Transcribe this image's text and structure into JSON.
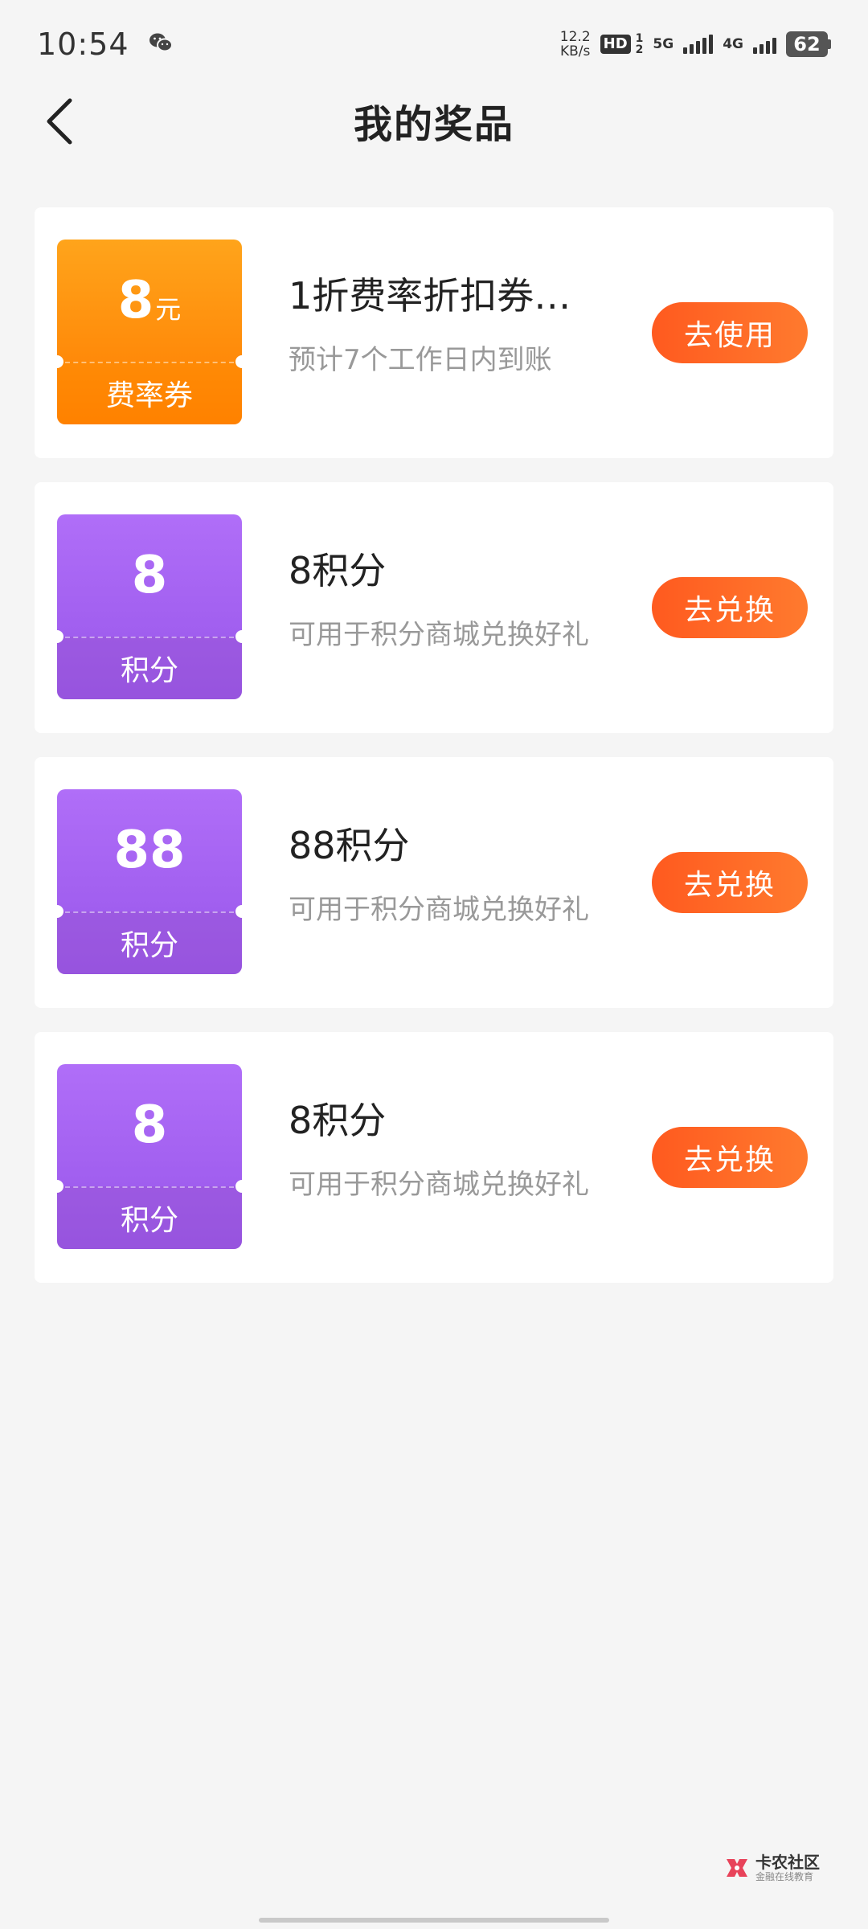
{
  "status_bar": {
    "time": "10:54",
    "net_speed_value": "12.2",
    "net_speed_unit": "KB/s",
    "hd_label": "HD",
    "sim1_label": "5G",
    "sim2_label": "4G",
    "battery": "62"
  },
  "header": {
    "title": "我的奖品"
  },
  "prizes": [
    {
      "badge_value": "8",
      "badge_unit": "元",
      "badge_label": "费率券",
      "title": "1折费率折扣券…",
      "description": "预计7个工作日内到账",
      "action_label": "去使用"
    },
    {
      "badge_value": "8",
      "badge_unit": "",
      "badge_label": "积分",
      "title": "8积分",
      "description": "可用于积分商城兑换好礼",
      "action_label": "去兑换"
    },
    {
      "badge_value": "88",
      "badge_unit": "",
      "badge_label": "积分",
      "title": "88积分",
      "description": "可用于积分商城兑换好礼",
      "action_label": "去兑换"
    },
    {
      "badge_value": "8",
      "badge_unit": "",
      "badge_label": "积分",
      "title": "8积分",
      "description": "可用于积分商城兑换好礼",
      "action_label": "去兑换"
    }
  ],
  "watermark": {
    "title": "卡农社区",
    "subtitle": "金融在线教育"
  },
  "colors": {
    "accent": "#ff6a26",
    "coupon_orange": "#ff8f0d",
    "points_purple": "#a463f2"
  }
}
